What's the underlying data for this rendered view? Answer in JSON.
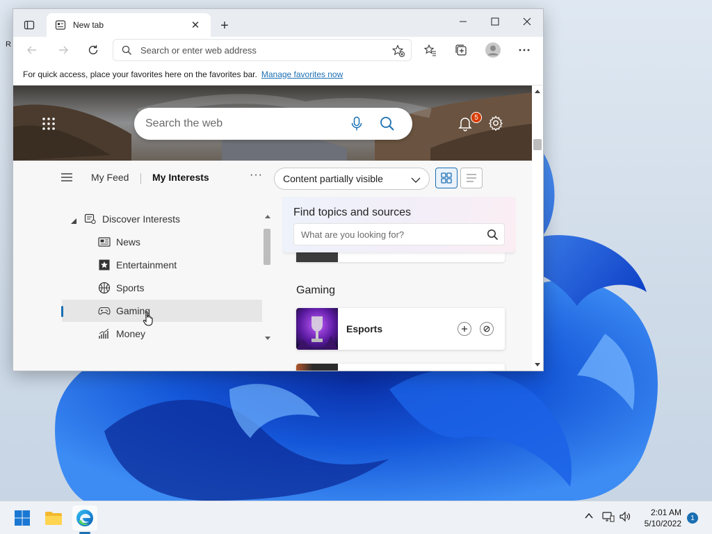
{
  "desktop": {
    "corner_text": "R"
  },
  "browser": {
    "tab": {
      "title": "New tab"
    },
    "address": {
      "placeholder": "Search or enter web address"
    },
    "favorites_bar": {
      "message": "For quick access, place your favorites here on the favorites bar.",
      "link": "Manage favorites now"
    }
  },
  "newtab": {
    "search": {
      "placeholder": "Search the web"
    },
    "notifications": {
      "count": "5"
    },
    "feed_tabs": [
      {
        "label": "My Feed"
      },
      {
        "label": "My Interests"
      }
    ],
    "content_visibility": "Content partially visible",
    "tree": {
      "root": "Discover Interests",
      "items": [
        {
          "label": "News"
        },
        {
          "label": "Entertainment"
        },
        {
          "label": "Sports"
        },
        {
          "label": "Gaming"
        },
        {
          "label": "Money"
        }
      ]
    },
    "find": {
      "title": "Find topics and sources",
      "placeholder": "What are you looking for?"
    },
    "section": {
      "title": "Gaming"
    },
    "card": {
      "name": "Esports"
    }
  },
  "taskbar": {
    "clock": {
      "time": "2:01 AM",
      "date": "5/10/2022"
    },
    "notification_count": "1"
  },
  "colors": {
    "accent": "#1a6fb3",
    "badge": "#d83b01"
  }
}
